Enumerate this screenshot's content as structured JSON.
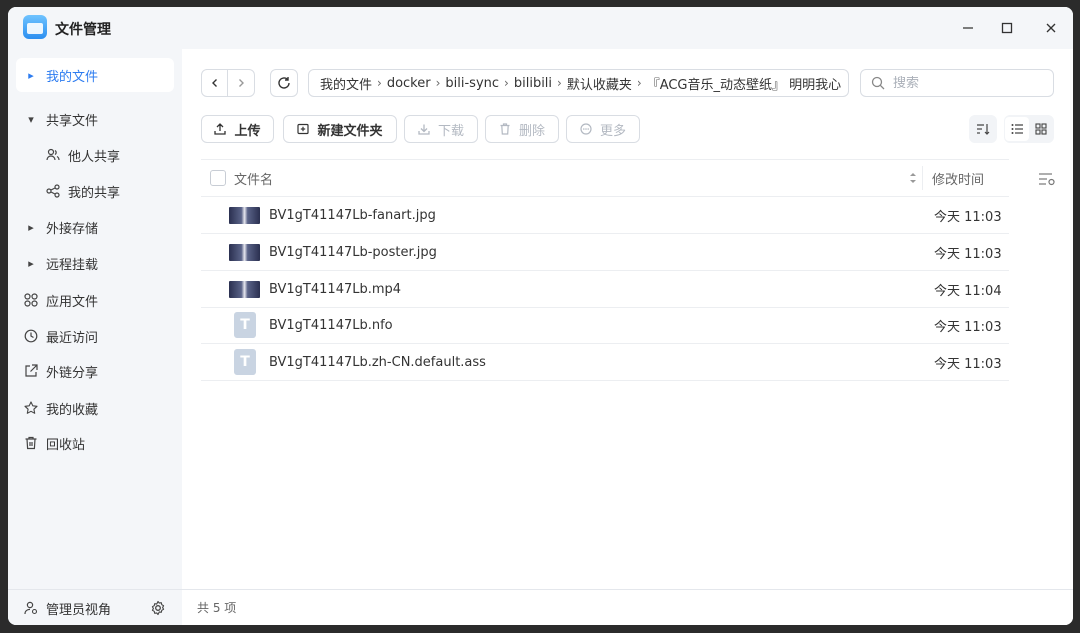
{
  "window": {
    "title": "文件管理"
  },
  "sidebar": {
    "items": [
      {
        "label": "我的文件"
      },
      {
        "label": "共享文件"
      },
      {
        "label": "他人共享"
      },
      {
        "label": "我的共享"
      },
      {
        "label": "外接存储"
      },
      {
        "label": "远程挂载"
      },
      {
        "label": "应用文件"
      },
      {
        "label": "最近访问"
      },
      {
        "label": "外链分享"
      },
      {
        "label": "我的收藏"
      },
      {
        "label": "回收站"
      }
    ],
    "footer_label": "管理员视角"
  },
  "breadcrumb": [
    "我的文件",
    "docker",
    "bili-sync",
    "bilibili",
    "默认收藏夹",
    "『ACG音乐_动态壁纸』 明明我心"
  ],
  "search": {
    "placeholder": "搜索"
  },
  "toolbar": {
    "upload": "上传",
    "new_folder": "新建文件夹",
    "download": "下载",
    "delete": "删除",
    "more": "更多"
  },
  "table": {
    "col_name": "文件名",
    "col_modified": "修改时间",
    "rows": [
      {
        "name": "BV1gT41147Lb-fanart.jpg",
        "modified": "今天 11:03",
        "icon": "image-thumbnail"
      },
      {
        "name": "BV1gT41147Lb-poster.jpg",
        "modified": "今天 11:03",
        "icon": "image-thumbnail"
      },
      {
        "name": "BV1gT41147Lb.mp4",
        "modified": "今天 11:04",
        "icon": "video-thumbnail"
      },
      {
        "name": "BV1gT41147Lb.nfo",
        "modified": "今天 11:03",
        "icon": "text-file-icon"
      },
      {
        "name": "BV1gT41147Lb.zh-CN.default.ass",
        "modified": "今天 11:03",
        "icon": "text-file-icon"
      }
    ]
  },
  "status": {
    "count": "共 5 项"
  },
  "colors": {
    "accent": "#2d7cf0",
    "sidebar_bg": "#f4f6f9"
  }
}
